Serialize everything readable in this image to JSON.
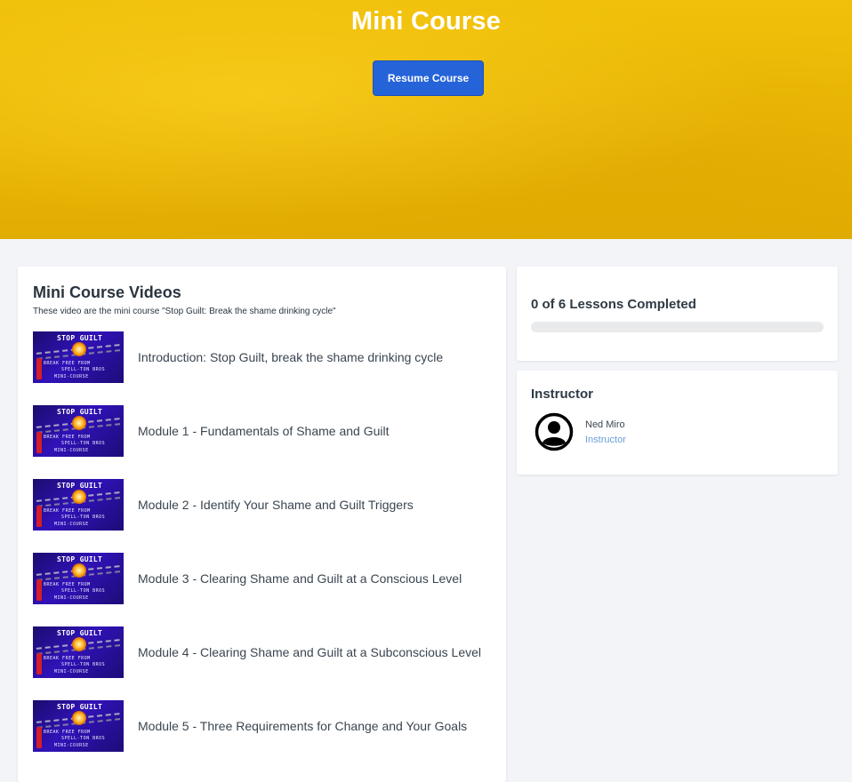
{
  "hero": {
    "title": "Mini Course",
    "resume_label": "Resume Course"
  },
  "videos": {
    "title": "Mini Course Videos",
    "subtitle": "These video are the mini course \"Stop Guilt: Break the shame drinking cycle\"",
    "thumbnail": {
      "title": "STOP GUILT",
      "line1": "BREAK FREE FROM",
      "line2": "SPELL-TON BROS",
      "line3": "MINI-COURSE"
    },
    "lessons": [
      {
        "label": "Introduction: Stop Guilt, break the shame drinking cycle"
      },
      {
        "label": "Module 1 - Fundamentals of Shame and Guilt"
      },
      {
        "label": "Module 2 - Identify Your Shame and Guilt Triggers"
      },
      {
        "label": "Module 3 - Clearing Shame and Guilt at a Conscious Level"
      },
      {
        "label": "Module 4 - Clearing Shame and Guilt at a Subconscious Level"
      },
      {
        "label": "Module 5 - Three Requirements for Change and Your Goals"
      }
    ]
  },
  "progress": {
    "text": "0 of 6 Lessons Completed",
    "completed": 0,
    "total": 6,
    "fraction": 0
  },
  "instructor": {
    "section_title": "Instructor",
    "name": "Ned Miro",
    "role": "Instructor",
    "avatar_icon": "user-circle-icon"
  },
  "colors": {
    "hero_yellow": "#ecb806",
    "primary_blue": "#2563d9",
    "link_blue": "#6a9fd8",
    "page_bg": "#f3f4f8"
  }
}
